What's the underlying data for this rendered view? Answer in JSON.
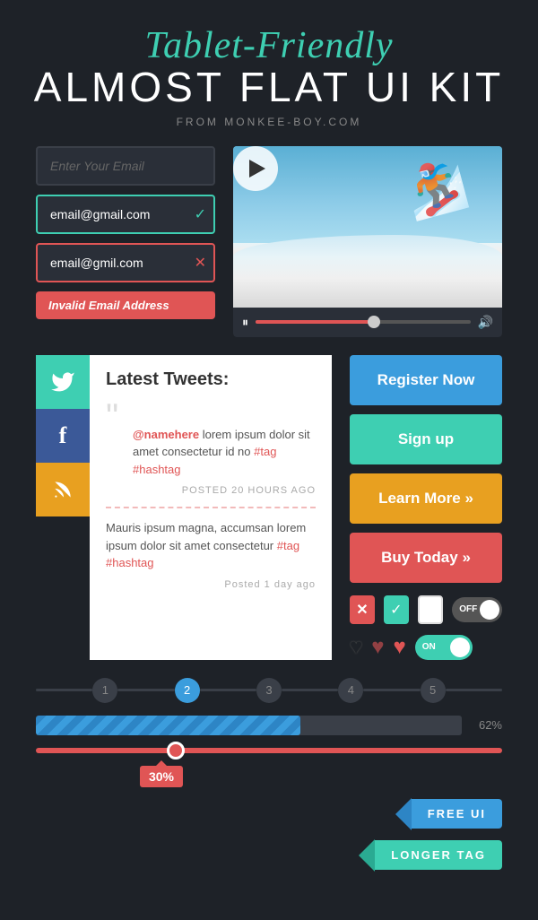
{
  "header": {
    "cursive_title": "Tablet-Friendly",
    "main_title": "ALMOST FLAT UI KIT",
    "subtitle": "FROM MONKEE-BOY.COM"
  },
  "email_section": {
    "placeholder": "Enter Your Email",
    "valid_email": "email@gmail.com",
    "invalid_email": "email@gmil.com",
    "error_message": "Invalid Email Address"
  },
  "video": {
    "pause_label": "⏸",
    "volume_label": "🔊"
  },
  "tweets": {
    "title": "Latest Tweets:",
    "tweet1": {
      "username": "@namehere",
      "text": " lorem ipsum dolor sit amet consectetur id no ",
      "tags": "#tag #hashtag",
      "timestamp": "POSTED 20 HOURS AGO"
    },
    "tweet2": {
      "text": "Mauris ipsum magna, accumsan lorem ipsum dolor sit amet consectetur ",
      "tags": "#tag #hashtag",
      "timestamp": "Posted 1 day ago"
    }
  },
  "buttons": {
    "register": "Register Now",
    "signup": "Sign up",
    "learn_more": "Learn More »",
    "buy_today": "Buy Today »"
  },
  "pagination": {
    "items": [
      "1",
      "2",
      "3",
      "4",
      "5"
    ],
    "active_index": 1
  },
  "progress": {
    "percent": 62,
    "label": "62%"
  },
  "slider": {
    "percent": 30,
    "label": "30%"
  },
  "checkboxes": {
    "x_label": "✕",
    "check_label": "✓"
  },
  "toggles": {
    "off_label": "OFF",
    "on_label": "ON"
  },
  "tags": {
    "free_ui": "FREE UI",
    "longer_tag": "LONGER TAG"
  },
  "social": {
    "twitter_icon": "🐦",
    "facebook_icon": "f",
    "rss_icon": "◉"
  }
}
